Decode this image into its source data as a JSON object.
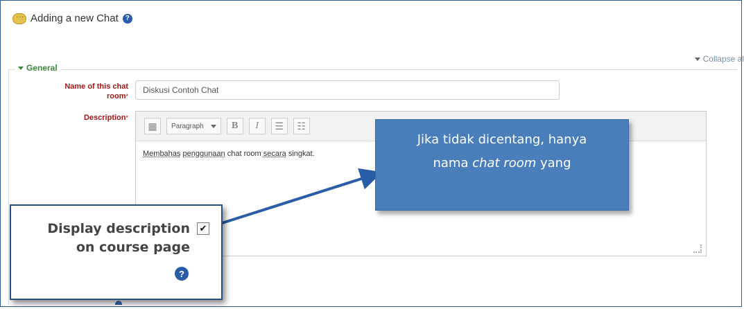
{
  "header": {
    "title": "Adding a new Chat",
    "title_icon": "chat-icon",
    "help_icon": "help-icon"
  },
  "collapse": {
    "label": "Collapse al"
  },
  "section": {
    "legend": "General"
  },
  "fields": {
    "name": {
      "label_line1": "Name of this chat",
      "label_line2": "room",
      "required_mark": "*",
      "value": "Diskusi Contoh Chat"
    },
    "description": {
      "label": "Description",
      "required_mark": "*"
    }
  },
  "editor": {
    "paragraph_select": "Paragraph",
    "bold": "B",
    "italic": "I",
    "content_words": [
      "Membahas",
      "penggunaan",
      "chat room",
      "secara",
      "singkat."
    ]
  },
  "callout": {
    "line1": "Jika tidak dicentang, hanya",
    "line2_pre": "nama ",
    "line2_em": "chat room",
    "line2_post": " yang"
  },
  "zoom": {
    "label_line1": "Display description",
    "label_line2": "on course page",
    "checked": true,
    "check_glyph": "✔",
    "help_glyph": "?"
  },
  "colors": {
    "accent": "#2a5da8",
    "callout_bg": "#4a7ebb",
    "required": "#a01818",
    "section_legend": "#3a8a3a"
  }
}
